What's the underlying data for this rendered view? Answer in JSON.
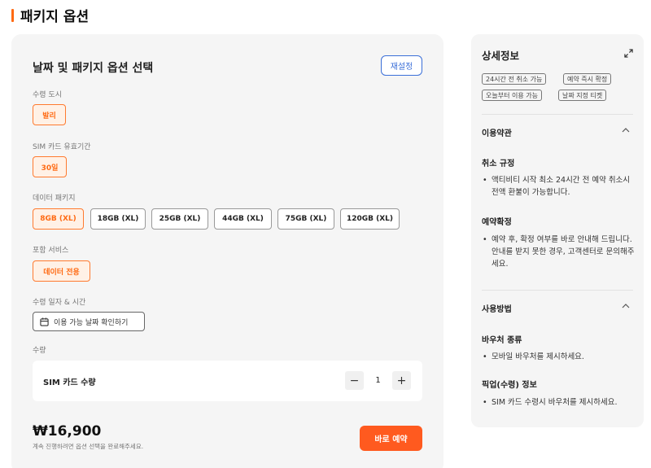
{
  "header": {
    "title": "패키지 옵션"
  },
  "options": {
    "title": "날짜 및 패키지 옵션 선택",
    "reset_label": "재설정",
    "city": {
      "label": "수령 도시",
      "options": [
        "발리"
      ],
      "selected": "발리"
    },
    "validity": {
      "label": "SIM 카드 유효기간",
      "options": [
        "30일"
      ],
      "selected": "30일"
    },
    "data_package": {
      "label": "데이터 패키지",
      "options": [
        "8GB (XL)",
        "18GB (XL)",
        "25GB (XL)",
        "44GB (XL)",
        "75GB (XL)",
        "120GB (XL)"
      ],
      "selected": "8GB (XL)"
    },
    "service": {
      "label": "포함 서비스",
      "options": [
        "데이터 전용"
      ],
      "selected": "데이터 전용"
    },
    "date": {
      "label": "수령 일자 & 시간",
      "button_label": "이용 가능 날짜 확인하기"
    },
    "quantity": {
      "label": "수량",
      "item_label": "SIM 카드 수량",
      "value": "1",
      "minus": "−",
      "plus": "+"
    },
    "price": "₩16,900",
    "price_note": "계속 진행하려면 옵션 선택을 완료해주세요.",
    "book_label": "바로 예약"
  },
  "details": {
    "title": "상세정보",
    "tags": [
      "24시간 전 취소 가능",
      "예약 즉시 확정",
      "오늘부터 이용 가능",
      "날짜 지정 티켓"
    ],
    "terms": {
      "title": "이용약관",
      "cancel_title": "취소 규정",
      "cancel_text": "액티비티 시작 최소 24시간 전 예약 취소시 전액 환불이 가능합니다.",
      "confirm_title": "예약확정",
      "confirm_text": "예약 후, 확정 여부를 바로 안내해 드립니다. 안내를 받지 못한 경우, 고객센터로 문의해주세요."
    },
    "usage": {
      "title": "사용방법",
      "voucher_title": "바우처 종류",
      "voucher_text": "모바일 바우처를 제시하세요.",
      "pickup_title": "픽업(수령) 정보",
      "pickup_text": "SIM 카드 수령시 바우처를 제시하세요."
    }
  },
  "colors": {
    "accent": "#ff5a1f",
    "selected_bg": "#fff1e6",
    "link_blue": "#3b6fd8"
  }
}
